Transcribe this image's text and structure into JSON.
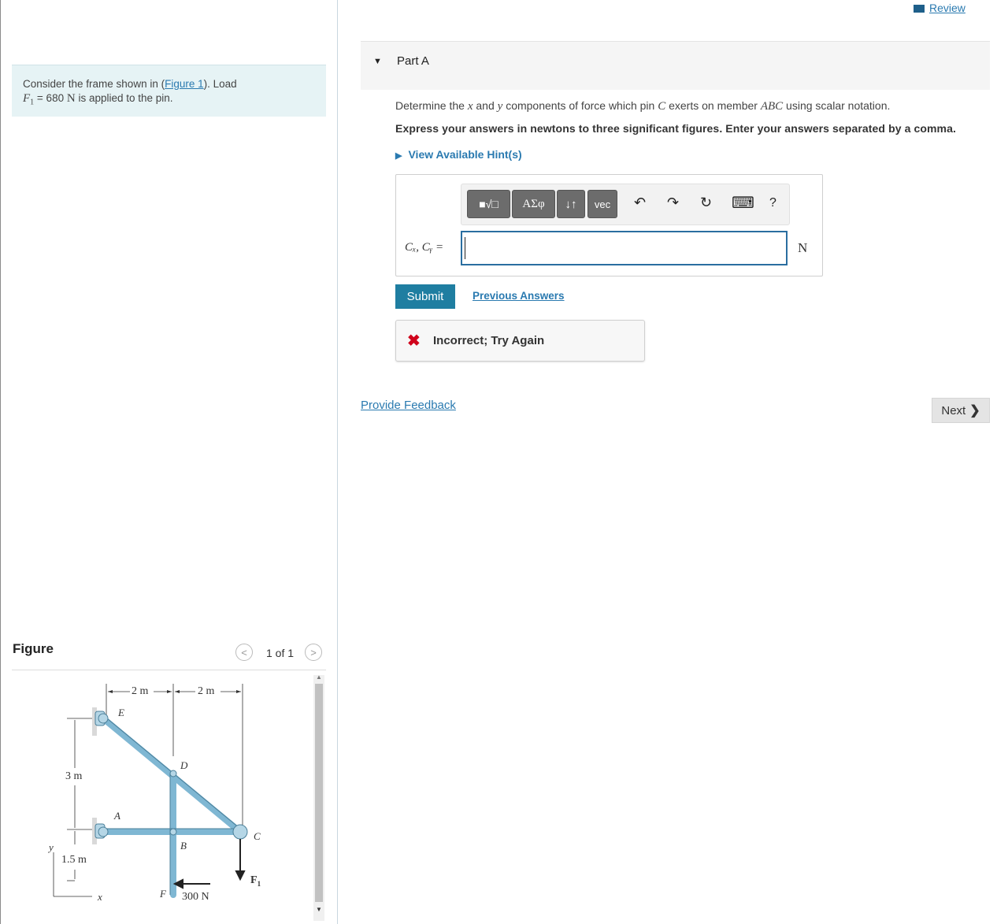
{
  "problem": {
    "text_before_link": "Consider the frame shown in (",
    "figure_link": "Figure 1",
    "text_after_link": "). Load",
    "load_symbol": "F",
    "load_sub": "1",
    "load_eq": " = 680 ",
    "load_unit": "N",
    "load_rest": " is applied to the pin."
  },
  "figure": {
    "title": "Figure",
    "counter": "1 of 1",
    "dims": {
      "top_left": "2 m",
      "top_right": "2 m",
      "left_upper": "3 m",
      "left_lower": "1.5 m"
    },
    "labels": {
      "E": "E",
      "D": "D",
      "A": "A",
      "B": "B",
      "C": "C",
      "F": "F",
      "F1": "F",
      "F1_sub": "1",
      "force": "300 N",
      "x": "x",
      "y": "y"
    }
  },
  "header": {
    "review": "Review"
  },
  "part": {
    "title": "Part A",
    "question_pre": "Determine the ",
    "question_x": "x",
    "question_and": " and ",
    "question_y": "y",
    "question_mid": " components of force which pin ",
    "question_C": "C",
    "question_mid2": " exerts on member ",
    "question_ABC": "ABC",
    "question_post": " using scalar notation.",
    "instruction": "Express your answers in newtons to three significant figures. Enter your answers separated by a comma.",
    "hints": "View Available Hint(s)"
  },
  "toolbar": {
    "templates": "■√□",
    "greek": "ΑΣφ",
    "arrows": "↓↑",
    "vec": "vec",
    "undo": "↶",
    "redo": "↷",
    "reset": "↻",
    "keyboard": "⌨",
    "help": "?"
  },
  "answer": {
    "label": "Cₓ, Cᵧ =",
    "value": "",
    "unit": "N"
  },
  "actions": {
    "submit": "Submit",
    "previous": "Previous Answers"
  },
  "feedback": {
    "icon": "✖",
    "text": "Incorrect; Try Again"
  },
  "footer": {
    "provide_feedback": "Provide Feedback",
    "next": "Next"
  }
}
